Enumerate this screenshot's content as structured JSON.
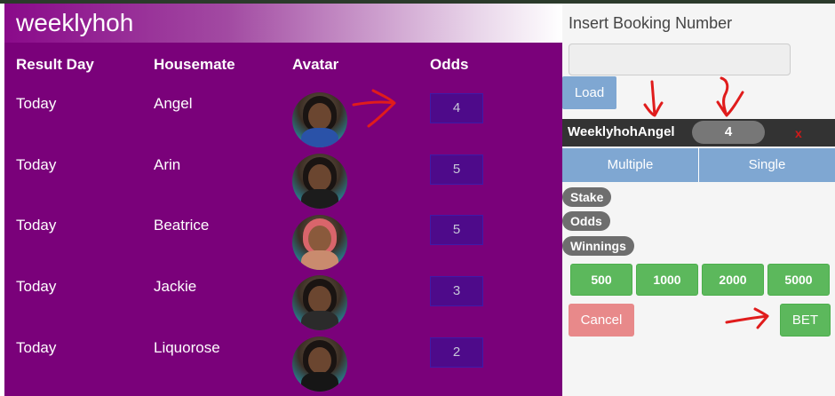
{
  "app": {
    "title": "weeklyhoh"
  },
  "table": {
    "headers": [
      "Result Day",
      "Housemate",
      "Avatar",
      "Odds"
    ],
    "rows": [
      {
        "day": "Today",
        "housemate": "Angel",
        "odds": "4",
        "outfit_color": "#2a52a8"
      },
      {
        "day": "Today",
        "housemate": "Arin",
        "odds": "5",
        "outfit_color": "#1c1c1c"
      },
      {
        "day": "Today",
        "housemate": "Beatrice",
        "odds": "5",
        "outfit_color": "#c98b6e"
      },
      {
        "day": "Today",
        "housemate": "Jackie",
        "odds": "3",
        "outfit_color": "#2b2b2b"
      },
      {
        "day": "Today",
        "housemate": "Liquorose",
        "odds": "2",
        "outfit_color": "#161616"
      }
    ]
  },
  "booking": {
    "label": "Insert Booking Number",
    "input_value": "",
    "load_label": "Load"
  },
  "betslip": {
    "selection": "WeeklyhohAngel",
    "odds": "4",
    "remove_label": "x"
  },
  "bet_type": {
    "multiple_label": "Multiple",
    "single_label": "Single"
  },
  "summary": {
    "stake_label": "Stake",
    "odds_label": "Odds",
    "winnings_label": "Winnings"
  },
  "stakes": [
    "500",
    "1000",
    "2000",
    "5000"
  ],
  "actions": {
    "cancel_label": "Cancel",
    "bet_label": "BET"
  },
  "colors": {
    "panel_purple": "#7a017a",
    "odds_box": "#4e0a8a",
    "button_blue": "#7fa7d2",
    "button_green": "#5cb85c",
    "cancel_red": "#e8898a",
    "annotation_red": "#e01c1c"
  }
}
